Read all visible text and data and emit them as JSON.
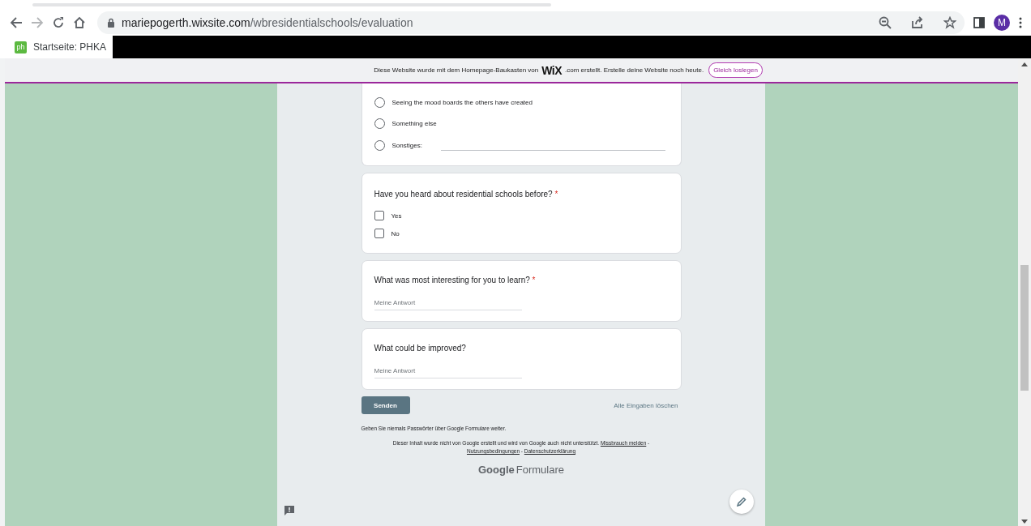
{
  "browser": {
    "url_host": "mariepogerth.wixsite.com",
    "url_path": "/wbresidentialschools/evaluation",
    "profile_initial": "M",
    "bookmarks": [
      {
        "label": "Startseite: PHKA",
        "icon_text": "ph"
      }
    ]
  },
  "wix_banner": {
    "text_before": "Diese Website wurde mit dem Homepage-Baukasten von",
    "logo": "WiX",
    "text_after": ".com erstellt. Erstelle deine Website noch heute.",
    "button": "Gleich loslegen"
  },
  "questions": [
    {
      "kind": "radio",
      "options": [
        {
          "label": "Seeing the mood boards the others have created",
          "selected": false
        },
        {
          "label": "Something else",
          "selected": false
        },
        {
          "label": "Sonstiges:",
          "selected": false,
          "kind": "other"
        }
      ]
    },
    {
      "kind": "checkbox",
      "title": "Have you heard about residential schools before?",
      "required_mark": "*",
      "options": [
        {
          "label": "Yes",
          "checked": false
        },
        {
          "label": "No",
          "checked": false
        }
      ]
    },
    {
      "kind": "text",
      "title": "What was most interesting for you to learn?",
      "required_mark": "*",
      "placeholder": "Meine Antwort"
    },
    {
      "kind": "text",
      "title": "What could be improved?",
      "placeholder": "Meine Antwort"
    }
  ],
  "submit_button": "Senden",
  "clear_link": "Alle Eingaben löschen",
  "password_note": "Geben Sie niemals Passwörter über Google Formulare weiter.",
  "disclaimer": "Dieser Inhalt wurde nicht von Google erstellt und wird von Google auch nicht unterstützt.",
  "footer_separator": "-",
  "footer_links": [
    "Missbrauch melden",
    "Nutzungsbedingungen",
    "Datenschutzerklärung"
  ],
  "brand": {
    "strong": "Google",
    "light": "Formulare"
  }
}
